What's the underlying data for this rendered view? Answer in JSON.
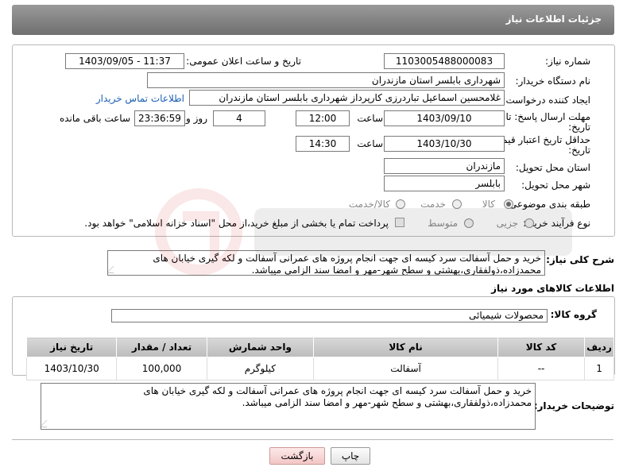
{
  "header": {
    "title": "جزئیات اطلاعات نیاز"
  },
  "form": {
    "need_number_label": "شماره نیاز:",
    "need_number": "1103005488000083",
    "announce_label": "تاریخ و ساعت اعلان عمومی:",
    "announce_value": "1403/09/05 - 11:37",
    "buyer_org_label": "نام دستگاه خریدار:",
    "buyer_org": "شهرداری بابلسر استان مازندران",
    "creator_label": "ایجاد کننده درخواست:",
    "creator": "غلامحسین اسماعیل تباردرزی کارپرداز شهرداری بابلسر استان مازندران",
    "contact_link": "اطلاعات تماس خریدار",
    "deadline_label_1": "مهلت ارسال پاسخ: تا",
    "deadline_label_2": "تاریخ:",
    "deadline_date": "1403/09/10",
    "time_label": "ساعت",
    "deadline_time": "12:00",
    "days_value": "4",
    "days_label": "روز و",
    "remaining_time": "23:36:59",
    "remaining_label": "ساعت باقی مانده",
    "validity_label_1": "حداقل تاریخ اعتبار قیمت: تا",
    "validity_label_2": "تاریخ:",
    "validity_date": "1403/10/30",
    "validity_time": "14:30",
    "province_label": "استان محل تحویل:",
    "province": "مازندران",
    "city_label": "شهر محل تحویل:",
    "city": "بابلسر",
    "category_label": "طبقه بندی موضوعی:",
    "category_options": [
      "کالا",
      "خدمت",
      "کالا/خدمت"
    ],
    "process_label": "نوع فرآیند خرید :",
    "process_options": [
      "جزیی",
      "متوسط"
    ],
    "payment_note": "پرداخت تمام یا بخشی از مبلغ خرید،از محل \"اسناد خزانه اسلامی\" خواهد بود."
  },
  "summary": {
    "label": "شرح کلی نیاز:",
    "text": "خرید و حمل آسفالت سرد کیسه ای جهت انجام پروژه های عمرانی آسفالت و لکه گیری خیابان های محمدزاده،ذولفقاری،بهشتی و سطح شهر-مهر و امضا سند الزامی میباشد."
  },
  "goods": {
    "section_title": "اطلاعات کالاهای مورد نیاز",
    "group_label": "گروه کالا:",
    "group_value": "محصولات شیمیائی",
    "columns": [
      "ردیف",
      "کد کالا",
      "نام کالا",
      "واحد شمارش",
      "تعداد / مقدار",
      "تاریخ نیاز"
    ],
    "rows": [
      [
        "1",
        "--",
        "آسفالت",
        "کیلوگرم",
        "100,000",
        "1403/10/30"
      ]
    ]
  },
  "buyer_notes": {
    "label": "توضیحات خریدار:",
    "text": "خرید و حمل آسفالت سرد کیسه ای جهت انجام پروژه های عمرانی آسفالت و لکه گیری خیابان های محمدزاده،ذولفقاری،بهشتی و سطح شهر-مهر و امضا سند الزامی میباشد."
  },
  "buttons": {
    "print": "چاپ",
    "back": "بازگشت"
  },
  "colors": {
    "header_bg": "#7f7f7f",
    "link": "#1a5fb4",
    "back_button": "#f2c6c6"
  }
}
